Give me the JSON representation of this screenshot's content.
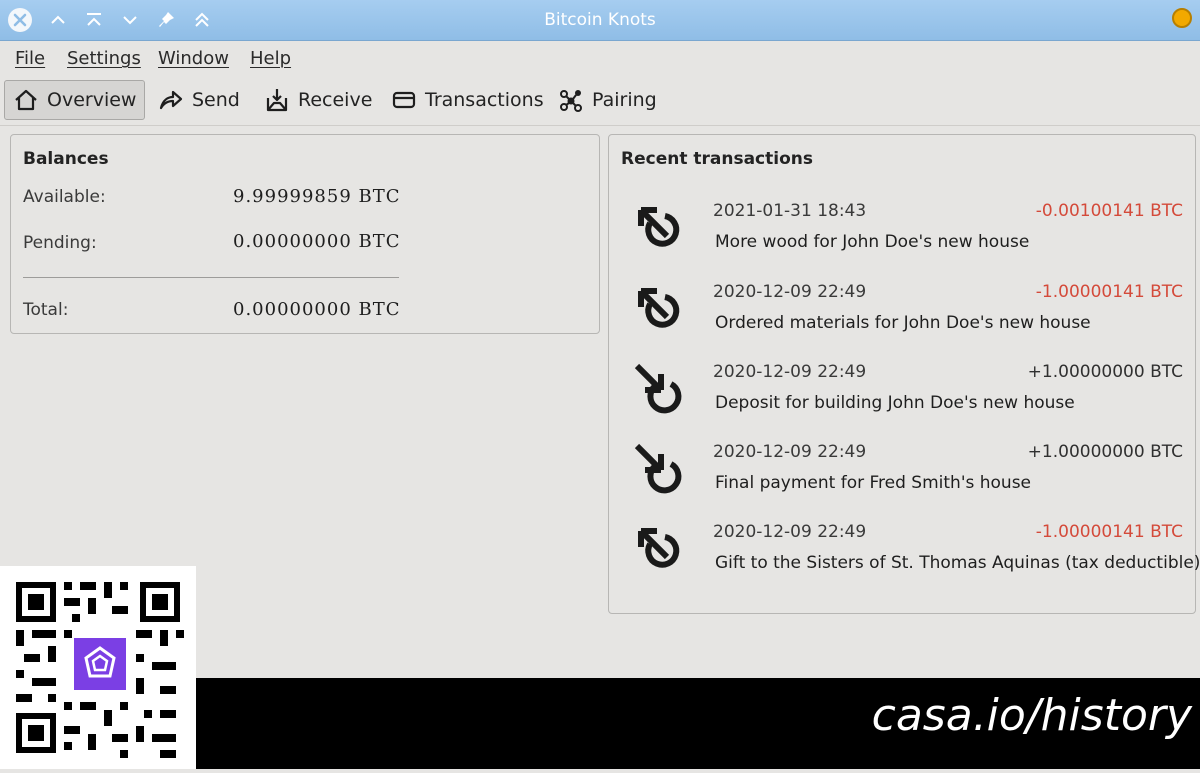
{
  "window": {
    "title": "Bitcoin Knots"
  },
  "menu": [
    {
      "label": "File"
    },
    {
      "label": "Settings"
    },
    {
      "label": "Window"
    },
    {
      "label": "Help"
    }
  ],
  "toolbar": [
    {
      "label": "Overview",
      "icon": "home-icon",
      "active": true
    },
    {
      "label": "Send",
      "icon": "send-arrow-icon",
      "active": false
    },
    {
      "label": "Receive",
      "icon": "receive-inbox-icon",
      "active": false
    },
    {
      "label": "Transactions",
      "icon": "transactions-card-icon",
      "active": false
    },
    {
      "label": "Pairing",
      "icon": "pairing-nodes-icon",
      "active": false
    }
  ],
  "balances": {
    "title": "Balances",
    "available_label": "Available:",
    "available_value": "9.99999859 BTC",
    "pending_label": "Pending:",
    "pending_value": "0.00000000 BTC",
    "total_label": "Total:",
    "total_value": "0.00000000 BTC"
  },
  "recent": {
    "title": "Recent transactions",
    "transactions": [
      {
        "date": "2021-01-31 18:43",
        "amount": "-0.00100141 BTC",
        "direction": "sent",
        "description": "More wood for John Doe's new house"
      },
      {
        "date": "2020-12-09 22:49",
        "amount": "-1.00000141 BTC",
        "direction": "sent",
        "description": "Ordered materials for John Doe's new house"
      },
      {
        "date": "2020-12-09 22:49",
        "amount": "+1.00000000 BTC",
        "direction": "received",
        "description": "Deposit for building John Doe's new house"
      },
      {
        "date": "2020-12-09 22:49",
        "amount": "+1.00000000 BTC",
        "direction": "received",
        "description": "Final payment for Fred Smith's house"
      },
      {
        "date": "2020-12-09 22:49",
        "amount": "-1.00000141 BTC",
        "direction": "sent",
        "description": "Gift to the Sisters of St. Thomas Aquinas (tax deductible)"
      }
    ]
  },
  "footer": {
    "url": "casa.io/history"
  },
  "colors": {
    "negative": "#d44a3a",
    "titlebar": "#9cc6ec",
    "qr_logo": "#7b3fe4"
  }
}
